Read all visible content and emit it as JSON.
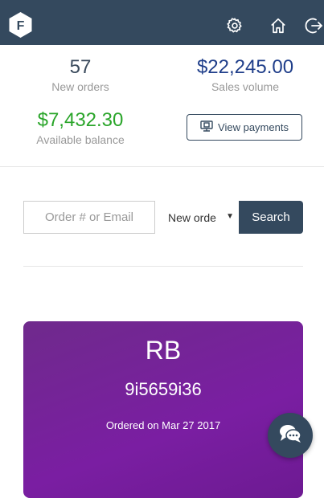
{
  "header": {
    "logo_letter": "F",
    "icons": [
      "gear-icon",
      "home-icon",
      "logout-icon"
    ]
  },
  "stats": {
    "new_orders_value": "57",
    "new_orders_label": "New orders",
    "sales_volume_value": "$22,245.00",
    "sales_volume_label": "Sales volume",
    "available_balance_value": "$7,432.30",
    "available_balance_label": "Available balance",
    "view_payments_label": "View payments"
  },
  "search": {
    "placeholder": "Order # or Email",
    "select_value": "New orders",
    "select_visible": "New orde",
    "button_label": "Search"
  },
  "order_card": {
    "initials": "RB",
    "order_id": "9i5659i36",
    "date_text": "Ordered on Mar 27 2017"
  },
  "colors": {
    "topbar": "#34495e",
    "sales_volume": "#1f3e8a",
    "balance": "#2aa52a",
    "card": "#7a1ea2"
  }
}
